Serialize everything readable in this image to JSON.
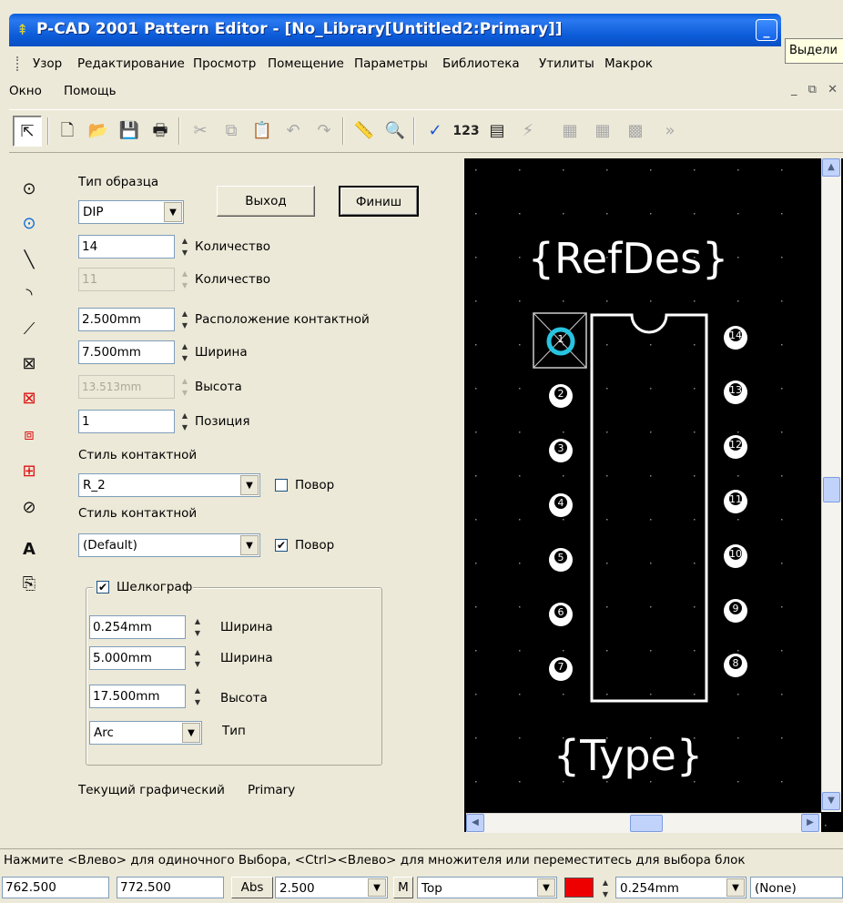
{
  "window": {
    "title": "P-CAD 2001 Pattern Editor - [No_Library[Untitled2:Primary]]",
    "tooltip": "Выдели"
  },
  "menu": {
    "items": [
      "Узор",
      "Редактирование",
      "Просмотр",
      "Помещение",
      "Параметры",
      "Библиотека",
      "Утилиты",
      "Макрок"
    ],
    "items2": [
      "Окно",
      "Помощь"
    ]
  },
  "panel": {
    "pattern_type_label": "Тип образца",
    "pattern_type_value": "DIP",
    "exit_button": "Выход",
    "finish_button": "Финиш",
    "pin_count": "14",
    "pin_count_label": "Количество",
    "pin_count2": "11",
    "pin_count2_label": "Количество",
    "pad_spacing": "2.500mm",
    "pad_spacing_label": "Расположение контактной",
    "width": "7.500mm",
    "width_label": "Ширина",
    "height": "13.513mm",
    "height_label": "Высота",
    "position": "1",
    "position_label": "Позиция",
    "pad_style1_label": "Стиль контактной",
    "pad_style1_value": "R_2",
    "rotate1_label": "Повор",
    "rotate1_checked": false,
    "pad_style2_label": "Стиль контактной",
    "pad_style2_value": "(Default)",
    "rotate2_label": "Повор",
    "rotate2_checked": true,
    "silk_label": "Шелкограф",
    "silk_checked": true,
    "silk_line_width": "0.254mm",
    "silk_line_width_label": "Ширина",
    "silk_width": "5.000mm",
    "silk_width_label": "Ширина",
    "silk_height": "17.500mm",
    "silk_height_label": "Высота",
    "silk_type": "Arc",
    "silk_type_label": "Тип",
    "current_layer_label": "Текущий графический",
    "current_layer_value": "Primary"
  },
  "canvas": {
    "refdes_text": "{RefDes}",
    "type_text": "{Type}",
    "pins_left": [
      "1",
      "2",
      "3",
      "4",
      "5",
      "6",
      "7"
    ],
    "pins_right": [
      "14",
      "13",
      "12",
      "11",
      "10",
      "9",
      "8"
    ]
  },
  "status": {
    "message": "Нажмите <Влево> для одиночного Выбора, <Ctrl><Влево> для множителя или переместитесь для выбора блок"
  },
  "bottombar": {
    "x_coord": "762.500",
    "y_coord": "772.500",
    "abs_button": "Abs",
    "grid": "2.500",
    "m_button": "M",
    "layer": "Top",
    "line_width": "0.254mm",
    "none_value": "(None)",
    "layer_color": "#ee0000"
  }
}
